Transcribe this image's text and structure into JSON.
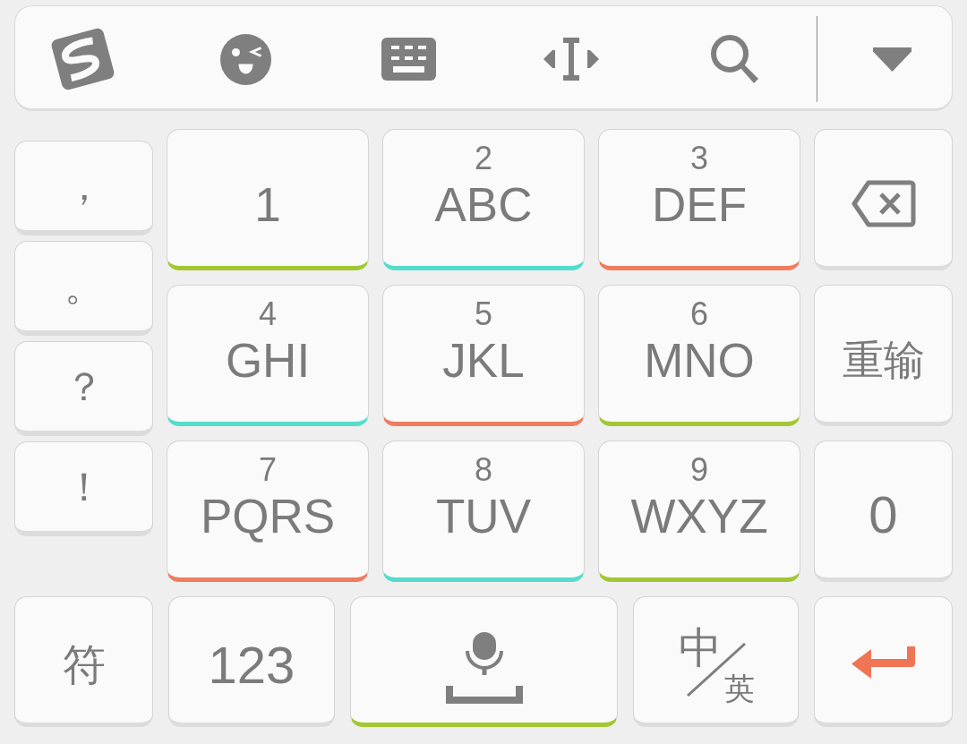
{
  "symbol_column": {
    "keys": [
      {
        "label": "，"
      },
      {
        "label": "。"
      },
      {
        "label": "？"
      },
      {
        "label": "！"
      }
    ]
  },
  "keypad": {
    "rows": [
      {
        "keys": [
          {
            "label": "1",
            "color": "#a3c733"
          },
          {
            "label": "ABC",
            "hint": "2",
            "color": "#55dccb"
          },
          {
            "label": "DEF",
            "hint": "3",
            "color": "#ee7d5f"
          }
        ]
      },
      {
        "keys": [
          {
            "label": "GHI",
            "hint": "4",
            "color": "#55dccb"
          },
          {
            "label": "JKL",
            "hint": "5",
            "color": "#ee7d5f"
          },
          {
            "label": "MNO",
            "hint": "6",
            "color": "#a3c733"
          }
        ]
      },
      {
        "keys": [
          {
            "label": "PQRS",
            "hint": "7",
            "color": "#ee7d5f"
          },
          {
            "label": "TUV",
            "hint": "8",
            "color": "#55dccb"
          },
          {
            "label": "WXYZ",
            "hint": "9",
            "color": "#a3c733"
          }
        ]
      }
    ]
  },
  "side_column": {
    "keys": [
      {
        "kind": "backspace"
      },
      {
        "kind": "word",
        "label": "重输"
      },
      {
        "kind": "number",
        "label": "0"
      }
    ]
  },
  "bottom_row": {
    "keys": [
      {
        "kind": "word",
        "label": "符"
      },
      {
        "kind": "number",
        "label": "123"
      },
      {
        "kind": "voice",
        "color": "#a3c733"
      },
      {
        "kind": "language",
        "primary": "中",
        "secondary": "英"
      },
      {
        "kind": "enter"
      }
    ]
  }
}
